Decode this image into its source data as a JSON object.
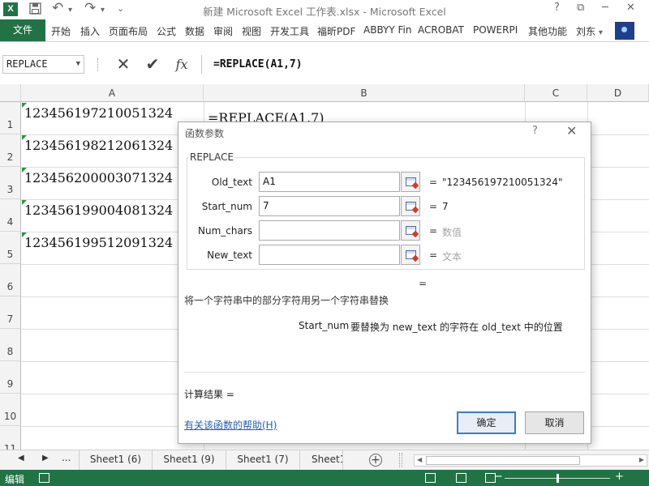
{
  "window": {
    "title": "新建 Microsoft Excel 工作表.xlsx - Microsoft Excel",
    "help": "?",
    "restore": "⧉",
    "minimize": "─",
    "close": "✕"
  },
  "quick_access": {
    "save_icon": "save-icon",
    "undo": "↶",
    "undo_dropdown": "▾",
    "redo": "↷",
    "redo_dropdown": "▾",
    "customize": "⌄"
  },
  "ribbon": {
    "file_tab": "文件",
    "tabs": [
      "开始",
      "插入",
      "页面布局",
      "公式",
      "数据",
      "审阅",
      "视图",
      "开发工具",
      "福昕PDF",
      "ABBYY Fin",
      "ACROBAT",
      "POWERPI",
      "其他功能"
    ],
    "user": "刘东",
    "user_dropdown": "▾"
  },
  "formula_bar": {
    "name_box": "REPLACE",
    "name_box_dropdown": "▼",
    "cancel": "✕",
    "enter": "✔",
    "fx": "fx",
    "formula": "=REPLACE(A1,7)"
  },
  "grid": {
    "columns": [
      "A",
      "B",
      "C",
      "D"
    ],
    "rows": [
      "1",
      "2",
      "3",
      "4",
      "5",
      "6",
      "7",
      "8",
      "9",
      "10",
      "11"
    ],
    "column_a": [
      "123456197210051324",
      "123456198212061324",
      "123456200003071324",
      "123456199004081324",
      "123456199512091324"
    ],
    "b1": "=REPLACE(A1,7)"
  },
  "dialog": {
    "title": "函数参数",
    "help": "?",
    "close": "✕",
    "function_name": "REPLACE",
    "args": [
      {
        "label": "Old_text",
        "value": "A1",
        "result": "\"123456197210051324\"",
        "muted": false
      },
      {
        "label": "Start_num",
        "value": "7",
        "result": "7",
        "muted": false
      },
      {
        "label": "Num_chars",
        "value": "",
        "result": "数值",
        "muted": true
      },
      {
        "label": "New_text",
        "value": "",
        "result": "文本",
        "muted": true
      }
    ],
    "equals": "=",
    "result_equals": "=",
    "description": "将一个字符串中的部分字符用另一个字符串替换",
    "param_name": "Start_num",
    "param_description": "要替换为 new_text 的字符在 old_text 中的位置",
    "calc_result": "计算结果 =",
    "help_link": "有关该函数的帮助(H)",
    "ok": "确定",
    "cancel": "取消"
  },
  "sheet_tabs": {
    "prev": "◀",
    "next": "▶",
    "ellipsis": "...",
    "tabs": [
      "Sheet1 (6)",
      "Sheet1 (9)",
      "Sheet1 (7)",
      "Sheet1"
    ],
    "add": "+",
    "scroll_left": "◀",
    "scroll_right": "▶"
  },
  "status_bar": {
    "mode": "编辑",
    "zoom_minus": "−",
    "zoom_plus": "+"
  },
  "colors": {
    "accent": "#217346",
    "link": "#1f5fb8",
    "ok_border": "#3a7bd5"
  }
}
